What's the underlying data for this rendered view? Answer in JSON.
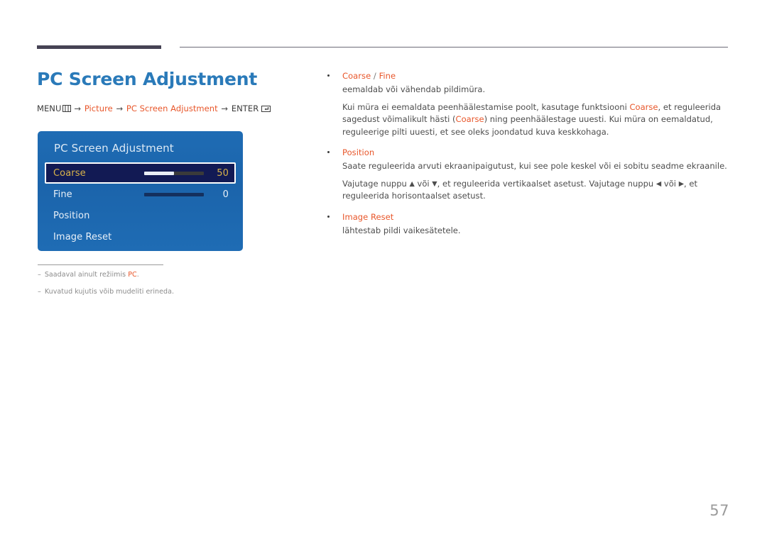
{
  "page": {
    "number": "57",
    "title": "PC Screen Adjustment"
  },
  "breadcrumb": {
    "menu_label": "MENU",
    "menu_icon": "menu-grid-icon",
    "arrow": "→",
    "item1": "Picture",
    "item2": "PC Screen Adjustment",
    "enter_label": "ENTER",
    "enter_icon": "enter-key-icon"
  },
  "osd": {
    "title": "PC Screen Adjustment",
    "rows": [
      {
        "label": "Coarse",
        "value": "50",
        "has_slider": true,
        "fill_percent": 50,
        "selected": true
      },
      {
        "label": "Fine",
        "value": "0",
        "has_slider": true,
        "fill_percent": 0,
        "selected": false
      },
      {
        "label": "Position",
        "value": "",
        "has_slider": false,
        "fill_percent": 0,
        "selected": false
      },
      {
        "label": "Image Reset",
        "value": "",
        "has_slider": false,
        "fill_percent": 0,
        "selected": false
      }
    ]
  },
  "footnotes": [
    {
      "dash": "–",
      "text_before": "Saadaval ainult režiimis ",
      "highlight": "PC",
      "text_after": "."
    },
    {
      "dash": "–",
      "text_before": "Kuvatud kujutis võib mudeliti erineda.",
      "highlight": "",
      "text_after": ""
    }
  ],
  "content": {
    "b1": {
      "head_a": "Coarse",
      "head_sep": " / ",
      "head_b": "Fine",
      "p1": "eemaldab või vähendab pildimüra.",
      "p2_a": "Kui müra ei eemaldata peenhäälestamise poolt, kasutage funktsiooni ",
      "p2_hl1": "Coarse",
      "p2_b": ", et reguleerida sagedust võimalikult hästi (",
      "p2_hl2": "Coarse",
      "p2_c": ") ning peenhäälestage uuesti. Kui müra on eemaldatud, reguleerige pilti uuesti, et see oleks joondatud kuva keskkohaga."
    },
    "b2": {
      "head": "Position",
      "p1": "Saate reguleerida arvuti ekraanipaigutust, kui see pole keskel või ei sobitu seadme ekraanile.",
      "p2_a": "Vajutage nuppu ",
      "p2_up": "▲",
      "p2_b": " või ",
      "p2_down": "▼",
      "p2_c": ", et reguleerida vertikaalset asetust. Vajutage nuppu ",
      "p2_left": "◀",
      "p2_d": " või ",
      "p2_right": "▶",
      "p2_e": ", et reguleerida horisontaalset asetust."
    },
    "b3": {
      "head": "Image Reset",
      "p1": "lähtestab pildi vaikesätetele."
    }
  },
  "colors": {
    "title_blue": "#2a7ab9",
    "accent_orange": "#e8562a",
    "osd_blue": "#1f6cb4",
    "osd_selected_bg": "#121a54",
    "osd_selected_text": "#d8b24a"
  }
}
